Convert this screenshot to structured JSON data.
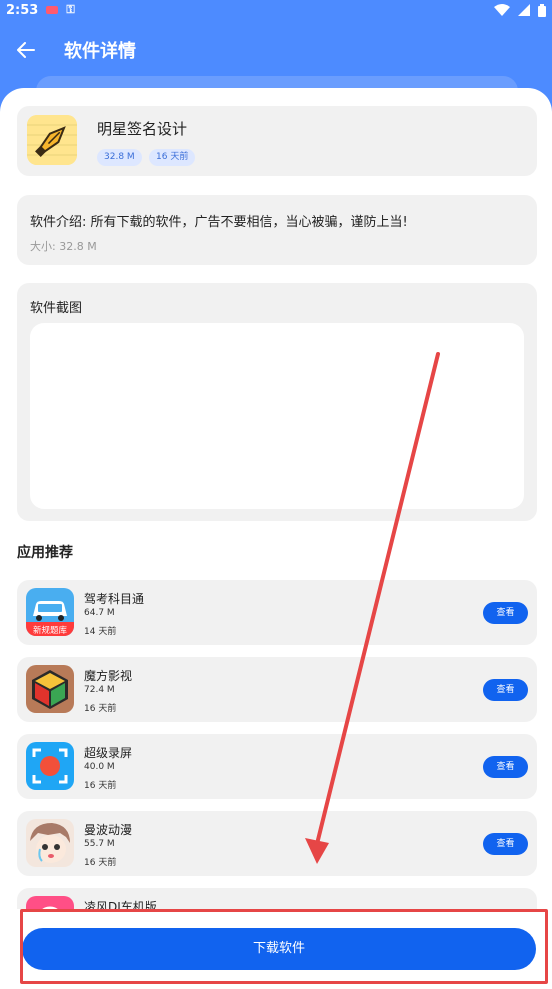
{
  "status_bar": {
    "time": "2:53"
  },
  "header": {
    "title": "软件详情"
  },
  "app": {
    "name": "明星签名设计",
    "size_badge": "32.8 M",
    "time_badge": "16 天前",
    "intro": "软件介绍: 所有下载的软件，广告不要相信，当心被骗，谨防上当!",
    "size_text": "大小:  32.8 M",
    "screenshots_label": "软件截图"
  },
  "recommend": {
    "title": "应用推荐",
    "view_label": "查看",
    "items": [
      {
        "name": "驾考科目通",
        "size": "64.7 M",
        "time": "14 天前",
        "icon_caption": "新规题库"
      },
      {
        "name": "魔方影视",
        "size": "72.4 M",
        "time": "16 天前"
      },
      {
        "name": "超级录屏",
        "size": "40.0 M",
        "time": "16 天前"
      },
      {
        "name": "曼波动漫",
        "size": "55.7 M",
        "time": "16 天前"
      },
      {
        "name": "凌风DJ车机版"
      }
    ]
  },
  "download": {
    "label": "下载软件"
  },
  "colors": {
    "brand": "#4d8bff",
    "button": "#1163ef",
    "annotation": "#e64646"
  }
}
